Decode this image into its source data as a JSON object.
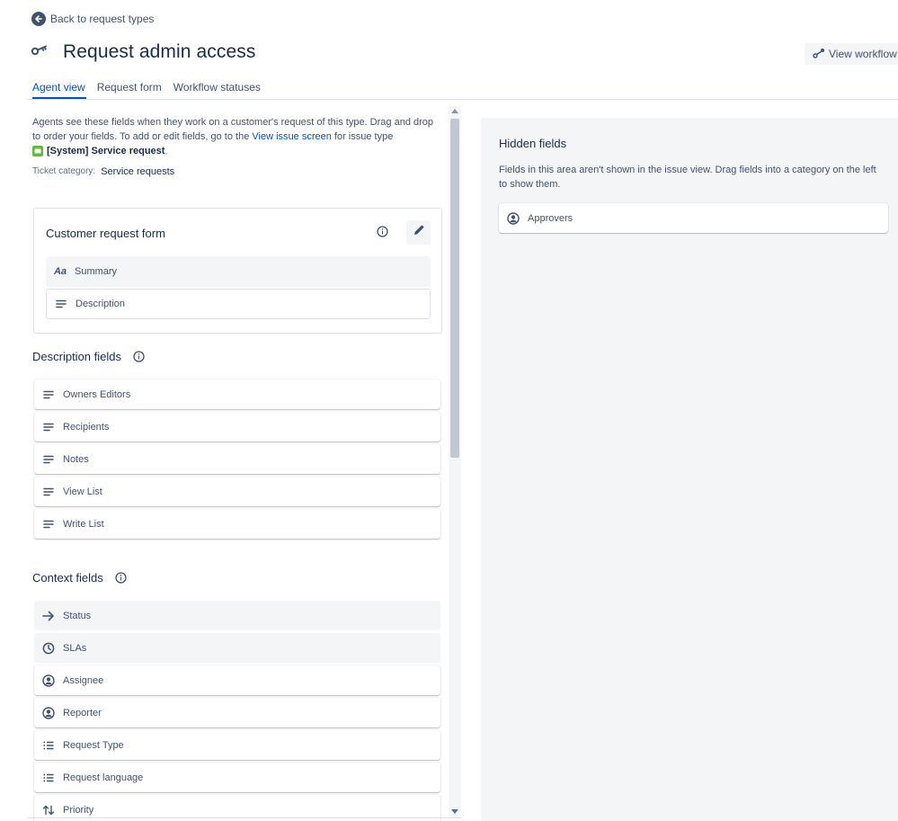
{
  "nav": {
    "back_label": "Back to request types"
  },
  "header": {
    "title": "Request admin access",
    "workflow_button": "View workflow"
  },
  "tabs": [
    {
      "label": "Agent view",
      "active": true
    },
    {
      "label": "Request form",
      "active": false
    },
    {
      "label": "Workflow statuses",
      "active": false
    }
  ],
  "intro": {
    "text_before_link": "Agents see these fields when they work on a customer's request of this type. Drag and drop to order your fields. To add or edit fields, go to the ",
    "link_text": "View issue screen",
    "text_after_link": " for issue type ",
    "issue_type": "[System] Service request",
    "period": "."
  },
  "ticket_category": {
    "label": "Ticket category:",
    "value": "Service requests"
  },
  "customer_request_form": {
    "title": "Customer request form",
    "fields": [
      {
        "label": "Summary",
        "icon": "text-aa-icon"
      },
      {
        "label": "Description",
        "icon": "paragraph-icon"
      }
    ]
  },
  "description_fields": {
    "title": "Description fields",
    "fields": [
      {
        "label": "Owners Editors",
        "icon": "paragraph-icon"
      },
      {
        "label": "Recipients",
        "icon": "paragraph-icon"
      },
      {
        "label": "Notes",
        "icon": "paragraph-icon"
      },
      {
        "label": "View List",
        "icon": "paragraph-icon"
      },
      {
        "label": "Write List",
        "icon": "paragraph-icon"
      }
    ]
  },
  "context_fields": {
    "title": "Context fields",
    "fields": [
      {
        "label": "Status",
        "icon": "arrow-right-icon"
      },
      {
        "label": "SLAs",
        "icon": "clock-icon"
      },
      {
        "label": "Assignee",
        "icon": "user-circle-icon"
      },
      {
        "label": "Reporter",
        "icon": "user-circle-icon"
      },
      {
        "label": "Request Type",
        "icon": "list-icon"
      },
      {
        "label": "Request language",
        "icon": "list-icon"
      },
      {
        "label": "Priority",
        "icon": "sort-arrows-icon"
      }
    ]
  },
  "hidden_fields": {
    "title": "Hidden fields",
    "description": "Fields in this area aren't shown in the issue view. Drag fields into a category on the left to show them.",
    "fields": [
      {
        "label": "Approvers",
        "icon": "user-circle-icon"
      }
    ]
  },
  "colors": {
    "text": "#172b4d",
    "subtle_text": "#42526e",
    "link": "#0052cc",
    "panel_bg": "#f4f5f7",
    "issue_badge": "#63ba3c"
  }
}
